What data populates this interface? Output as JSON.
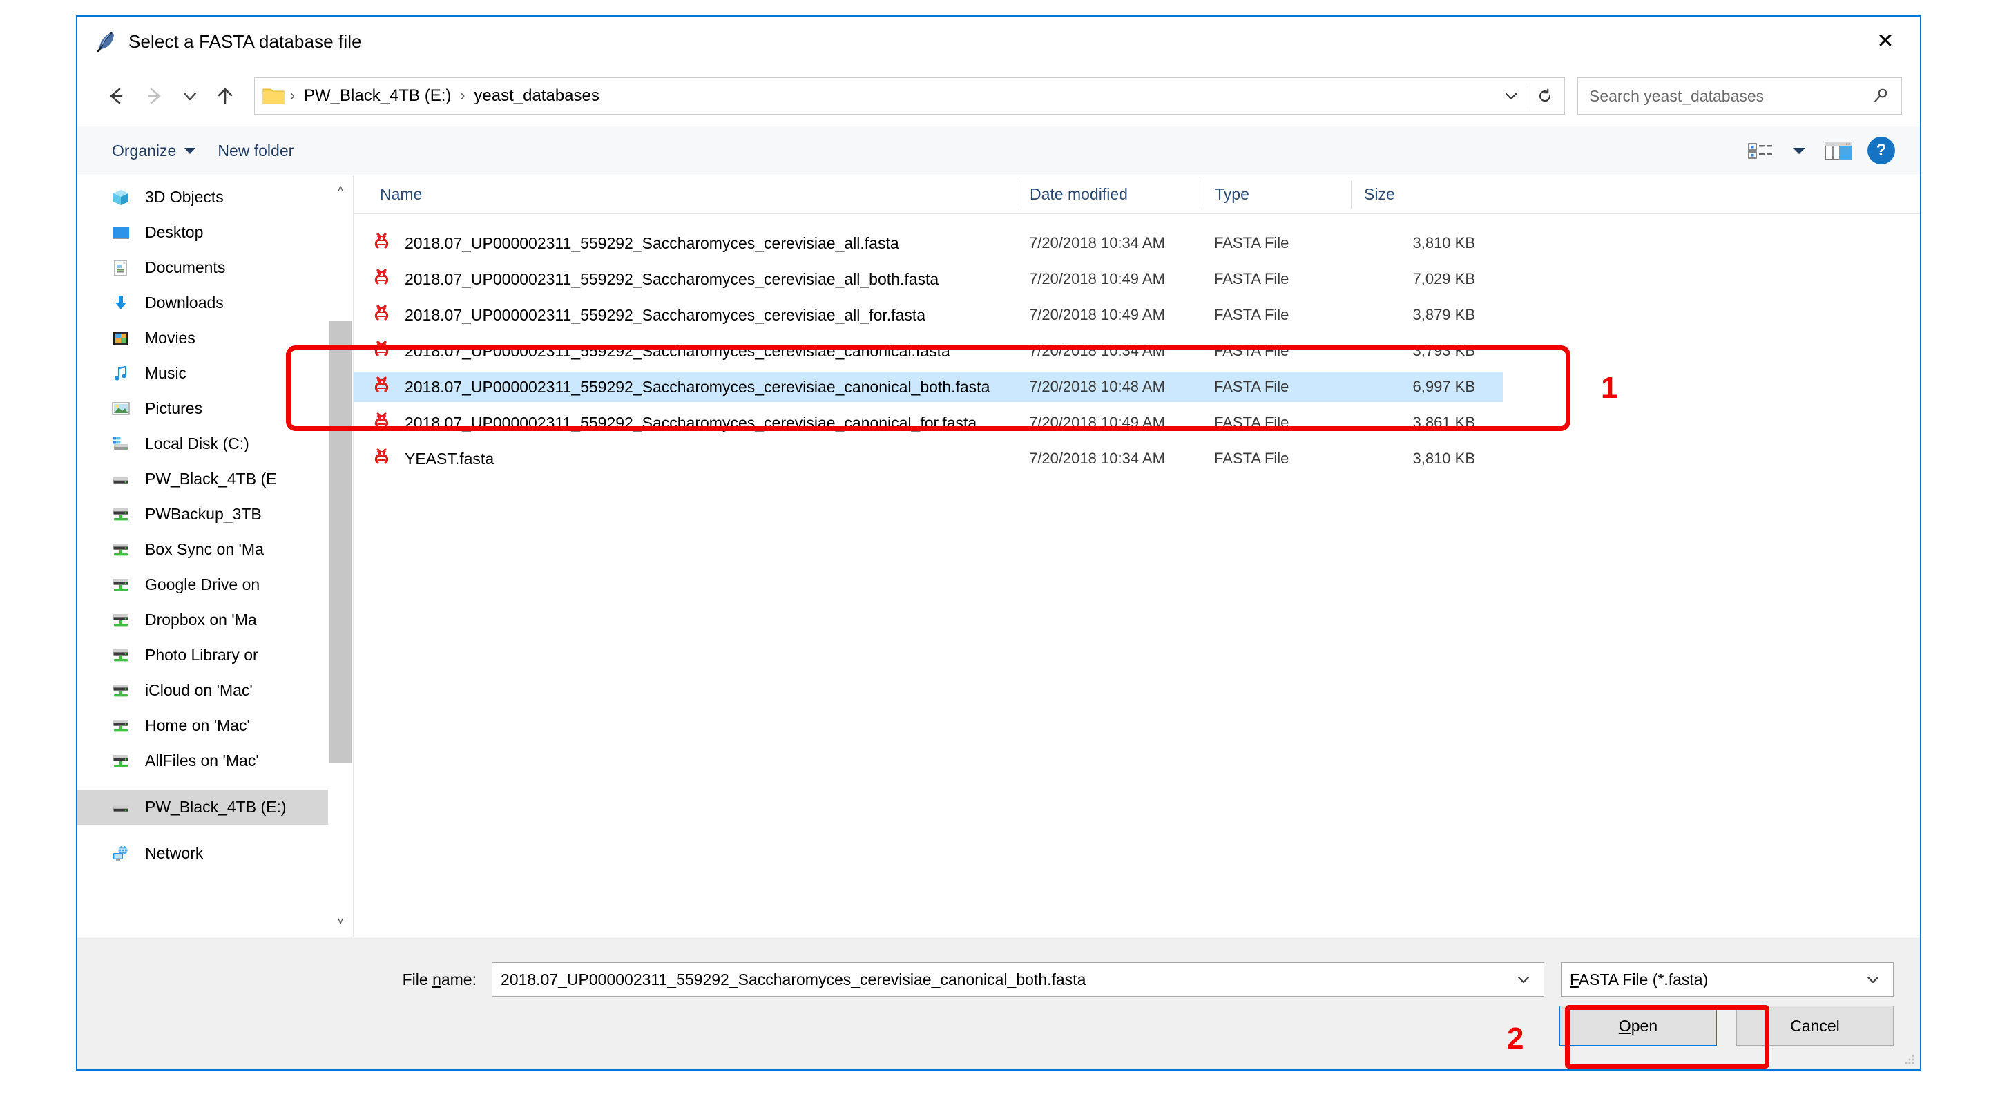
{
  "window": {
    "title": "Select a FASTA database file",
    "title_icon": "feather-quill-icon",
    "close_label": "✕"
  },
  "nav": {
    "back_label": "←",
    "forward_label": "→",
    "recent_label": "˅",
    "up_label": "↑",
    "breadcrumbs": [
      "PW_Black_4TB (E:)",
      "yeast_databases"
    ],
    "separator": "›",
    "dropdown_label": "˅",
    "refresh_label": "↻"
  },
  "search": {
    "placeholder": "Search yeast_databases",
    "icon": "search-icon"
  },
  "toolbar": {
    "organize_label": "Organize",
    "new_folder_label": "New folder",
    "view_icon": "list-view-icon",
    "view_caret": "▼",
    "preview_pane_icon": "preview-pane-icon",
    "help_label": "?"
  },
  "sidebar": {
    "items": [
      {
        "label": "3D Objects",
        "icon": "3d-objects-icon",
        "selected": false,
        "gap": false
      },
      {
        "label": "Desktop",
        "icon": "desktop-icon",
        "selected": false,
        "gap": false
      },
      {
        "label": "Documents",
        "icon": "documents-icon",
        "selected": false,
        "gap": false
      },
      {
        "label": "Downloads",
        "icon": "downloads-icon",
        "selected": false,
        "gap": false
      },
      {
        "label": "Movies",
        "icon": "movies-icon",
        "selected": false,
        "gap": false
      },
      {
        "label": "Music",
        "icon": "music-icon",
        "selected": false,
        "gap": false
      },
      {
        "label": "Pictures",
        "icon": "pictures-icon",
        "selected": false,
        "gap": false
      },
      {
        "label": "Local Disk (C:)",
        "icon": "local-disk-icon",
        "selected": false,
        "gap": false
      },
      {
        "label": "PW_Black_4TB (E",
        "icon": "drive-icon",
        "selected": false,
        "gap": false
      },
      {
        "label": "PWBackup_3TB",
        "icon": "network-drive-icon",
        "selected": false,
        "gap": false
      },
      {
        "label": "Box Sync on 'Ma",
        "icon": "network-drive-icon",
        "selected": false,
        "gap": false
      },
      {
        "label": "Google Drive on",
        "icon": "network-drive-icon",
        "selected": false,
        "gap": false
      },
      {
        "label": "Dropbox on 'Ma",
        "icon": "network-drive-icon",
        "selected": false,
        "gap": false
      },
      {
        "label": "Photo Library or",
        "icon": "network-drive-icon",
        "selected": false,
        "gap": false
      },
      {
        "label": "iCloud on 'Mac'",
        "icon": "network-drive-icon",
        "selected": false,
        "gap": false
      },
      {
        "label": "Home on 'Mac'",
        "icon": "network-drive-icon",
        "selected": false,
        "gap": false
      },
      {
        "label": "AllFiles on 'Mac'",
        "icon": "network-drive-icon",
        "selected": false,
        "gap": false
      },
      {
        "label": "PW_Black_4TB (E:)",
        "icon": "drive-icon",
        "selected": true,
        "gap": true
      },
      {
        "label": "Network",
        "icon": "network-icon",
        "selected": false,
        "gap": true
      }
    ],
    "scroll_up": "˄",
    "scroll_down": "˅"
  },
  "filelist": {
    "columns": [
      "Name",
      "Date modified",
      "Type",
      "Size"
    ],
    "sort_indicator": "˄",
    "rows": [
      {
        "name": "2018.07_UP000002311_559292_Saccharomyces_cerevisiae_all.fasta",
        "date": "7/20/2018 10:34 AM",
        "type": "FASTA File",
        "size": "3,810 KB",
        "icon": "fasta-file-icon",
        "selected": false
      },
      {
        "name": "2018.07_UP000002311_559292_Saccharomyces_cerevisiae_all_both.fasta",
        "date": "7/20/2018 10:49 AM",
        "type": "FASTA File",
        "size": "7,029 KB",
        "icon": "fasta-file-icon",
        "selected": false
      },
      {
        "name": "2018.07_UP000002311_559292_Saccharomyces_cerevisiae_all_for.fasta",
        "date": "7/20/2018 10:49 AM",
        "type": "FASTA File",
        "size": "3,879 KB",
        "icon": "fasta-file-icon",
        "selected": false
      },
      {
        "name": "2018.07_UP000002311_559292_Saccharomyces_cerevisiae_canonical.fasta",
        "date": "7/20/2018 10:34 AM",
        "type": "FASTA File",
        "size": "3,793 KB",
        "icon": "fasta-file-icon",
        "selected": false
      },
      {
        "name": "2018.07_UP000002311_559292_Saccharomyces_cerevisiae_canonical_both.fasta",
        "date": "7/20/2018 10:48 AM",
        "type": "FASTA File",
        "size": "6,997 KB",
        "icon": "fasta-file-icon",
        "selected": true
      },
      {
        "name": "2018.07_UP000002311_559292_Saccharomyces_cerevisiae_canonical_for.fasta",
        "date": "7/20/2018 10:49 AM",
        "type": "FASTA File",
        "size": "3,861 KB",
        "icon": "fasta-file-icon",
        "selected": false
      },
      {
        "name": "YEAST.fasta",
        "date": "7/20/2018 10:34 AM",
        "type": "FASTA File",
        "size": "3,810 KB",
        "icon": "fasta-file-icon",
        "selected": false
      }
    ]
  },
  "footer": {
    "filename_label_pre": "File ",
    "filename_label_key": "n",
    "filename_label_post": "ame:",
    "filename_value": "2018.07_UP000002311_559292_Saccharomyces_cerevisiae_canonical_both.fasta",
    "filename_chevron": "˅",
    "filter_pre": "",
    "filter_key": "F",
    "filter_post": "ASTA File (*.fasta)",
    "filter_chevron": "˅",
    "open_pre": "",
    "open_key": "O",
    "open_post": "pen",
    "cancel_label": "Cancel"
  },
  "annotations": {
    "callout_1": "1",
    "callout_2": "2",
    "color": "#f00000"
  }
}
